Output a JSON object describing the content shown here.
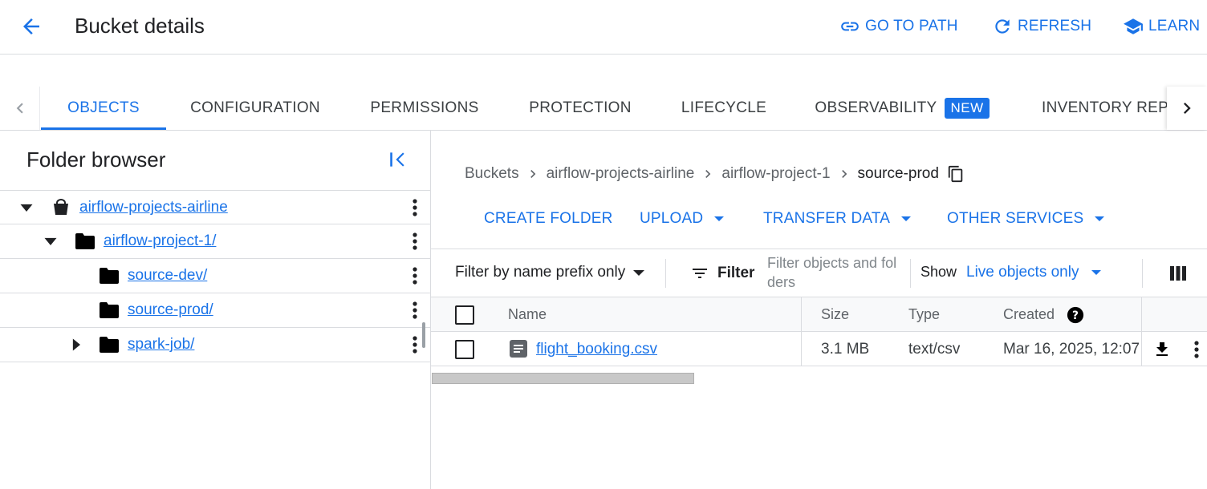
{
  "header": {
    "title": "Bucket details",
    "actions": [
      {
        "label": "GO TO PATH",
        "icon": "link-icon"
      },
      {
        "label": "REFRESH",
        "icon": "refresh-icon"
      },
      {
        "label": "LEARN",
        "icon": "school-icon"
      }
    ]
  },
  "tabs": {
    "items": [
      {
        "label": "OBJECTS",
        "active": true
      },
      {
        "label": "CONFIGURATION"
      },
      {
        "label": "PERMISSIONS"
      },
      {
        "label": "PROTECTION"
      },
      {
        "label": "LIFECYCLE"
      },
      {
        "label": "OBSERVABILITY",
        "badge": "NEW"
      },
      {
        "label": "INVENTORY REPO"
      }
    ]
  },
  "folder_browser": {
    "title": "Folder browser",
    "items": [
      {
        "label": "airflow-projects-airline",
        "type": "bucket",
        "expanded": true
      },
      {
        "label": "airflow-project-1/",
        "type": "folder",
        "expanded": true
      },
      {
        "label": "source-dev/",
        "type": "folder"
      },
      {
        "label": "source-prod/",
        "type": "folder"
      },
      {
        "label": "spark-job/",
        "type": "folder",
        "expanded": false
      }
    ]
  },
  "breadcrumb": {
    "items": [
      "Buckets",
      "airflow-projects-airline",
      "airflow-project-1",
      "source-prod"
    ]
  },
  "actions": {
    "create_folder": "CREATE FOLDER",
    "upload": "UPLOAD",
    "transfer_data": "TRANSFER DATA",
    "other_services": "OTHER SERVICES"
  },
  "filter": {
    "mode": "Filter by name prefix only",
    "label": "Filter",
    "placeholder": "Filter objects and folders",
    "show_label": "Show",
    "show_value": "Live objects only"
  },
  "table": {
    "columns": [
      "Name",
      "Size",
      "Type",
      "Created"
    ],
    "rows": [
      {
        "name": "flight_booking.csv",
        "size": "3.1 MB",
        "type": "text/csv",
        "created": "Mar 16, 2025, 12:07"
      }
    ]
  },
  "colors": {
    "accent": "#1a73e8",
    "text": "#202124",
    "muted": "#5f6368",
    "border": "#dadce0"
  }
}
